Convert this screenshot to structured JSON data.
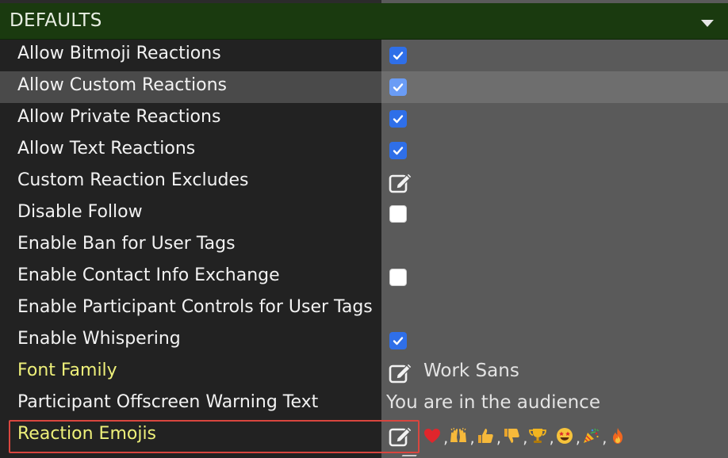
{
  "section": {
    "title": "DEFAULTS",
    "collapse_icon": "caret-down-icon"
  },
  "colors": {
    "header_bg": "#1a3a0f",
    "label_bg": "#222222",
    "value_bg": "#5a5a5a",
    "highlight_label_bg": "#4a4a4a",
    "highlight_value_bg": "#6e6e6e",
    "checkbox_checked": "#2f6fe8",
    "label_text": "#f2f2f2",
    "modified_label_text": "#eef07a",
    "focus_border": "#d9463f"
  },
  "rows": [
    {
      "label": "Allow Bitmoji Reactions",
      "type": "checkbox",
      "checked": true
    },
    {
      "label": "Allow Custom Reactions",
      "type": "checkbox",
      "checked": true,
      "highlighted": true
    },
    {
      "label": "Allow Private Reactions",
      "type": "checkbox",
      "checked": true
    },
    {
      "label": "Allow Text Reactions",
      "type": "checkbox",
      "checked": true
    },
    {
      "label": "Custom Reaction Excludes",
      "type": "edit",
      "value": ""
    },
    {
      "label": "Disable Follow",
      "type": "checkbox",
      "checked": false
    },
    {
      "label": "Enable Ban for User Tags",
      "type": "none"
    },
    {
      "label": "Enable Contact Info Exchange",
      "type": "checkbox",
      "checked": false
    },
    {
      "label": "Enable Participant Controls for User Tags",
      "type": "none"
    },
    {
      "label": "Enable Whispering",
      "type": "checkbox",
      "checked": true
    },
    {
      "label": "Font Family",
      "type": "edit",
      "value": "Work Sans",
      "modified": true
    },
    {
      "label": "Participant Offscreen Warning Text",
      "type": "text",
      "value": "You are in the audience"
    },
    {
      "label": "Reaction Emojis",
      "type": "emoji-edit",
      "modified": true,
      "focused": true,
      "emojis": [
        "red-heart",
        "raising-hands",
        "thumbs-up",
        "thumbs-down",
        "trophy",
        "star-struck",
        "party-popper",
        "fire"
      ]
    }
  ]
}
